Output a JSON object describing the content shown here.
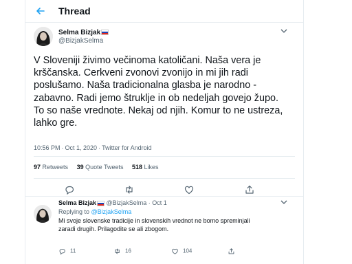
{
  "header": {
    "title": "Thread"
  },
  "main_tweet": {
    "author_name": "Selma Bizjak",
    "handle": "@BizjakSelma",
    "text": "V Sloveniji živimo večinoma katoličani. Naša vera je\nkrščanska. Cerkveni zvonovi zvonijo in mi jih radi\nposlušamo. Naša tradicionalna glasba je narodno -\nzabavno. Radi jemo štruklje in ob nedeljah govejo župo.\nTo so naše vrednote. Nekaj od njih. Komur to ne ustreza,\nlahko gre.",
    "time": "10:56 PM",
    "date": "Oct 1, 2020",
    "source": "Twitter for Android",
    "stats": {
      "retweets_count": "97",
      "retweets_label": "Retweets",
      "quotes_count": "39",
      "quotes_label": "Quote Tweets",
      "likes_count": "518",
      "likes_label": "Likes"
    }
  },
  "reply_tweet": {
    "author_name": "Selma Bizjak",
    "handle": "@BizjakSelma",
    "date": "Oct 1",
    "replying_prefix": "Replying to",
    "replying_to": "@BizjakSelma",
    "text": "Mi svoje slovenske tradicije in slovenskih vrednot ne bomo spreminjali\nzaradi drugih. Prilagodite se ali zbogom.",
    "replies": "11",
    "retweets": "16",
    "likes": "104"
  },
  "colors": {
    "accent": "#1da1f2",
    "secondary_text": "#536471",
    "border": "#e6ecf0"
  },
  "icons": [
    "back-arrow-icon",
    "more-icon",
    "reply-icon",
    "retweet-icon",
    "like-icon",
    "share-icon",
    "flag-icon"
  ]
}
